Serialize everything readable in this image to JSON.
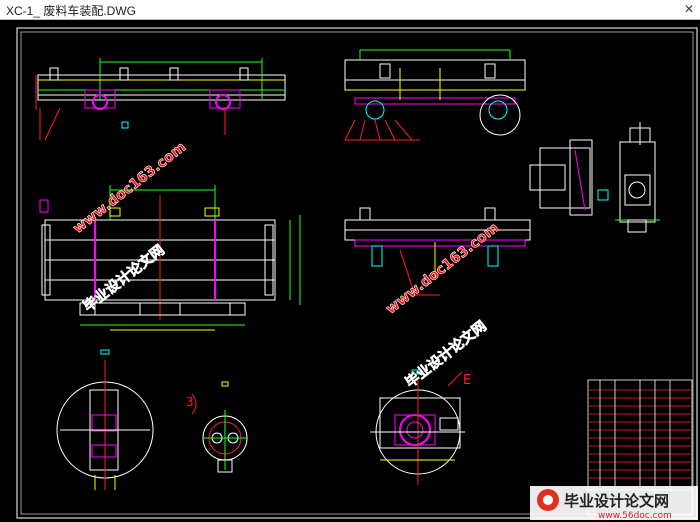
{
  "window": {
    "title": "XC-1_ 废料车装配.DWG",
    "close_glyph": "✕"
  },
  "drawing": {
    "label_e": "E",
    "label_3": "3"
  },
  "watermarks": {
    "site": "www.doc163.com",
    "name": "毕业设计论文网",
    "logo_name": "毕业设计论文网",
    "logo_url": "www.56doc.com"
  },
  "colors": {
    "frame": "#ffffff",
    "red": "#ff2020",
    "green": "#20ff20",
    "yellow": "#ffff00",
    "cyan": "#00ffff",
    "magenta": "#ff00ff",
    "watermark": "#ff1010"
  }
}
